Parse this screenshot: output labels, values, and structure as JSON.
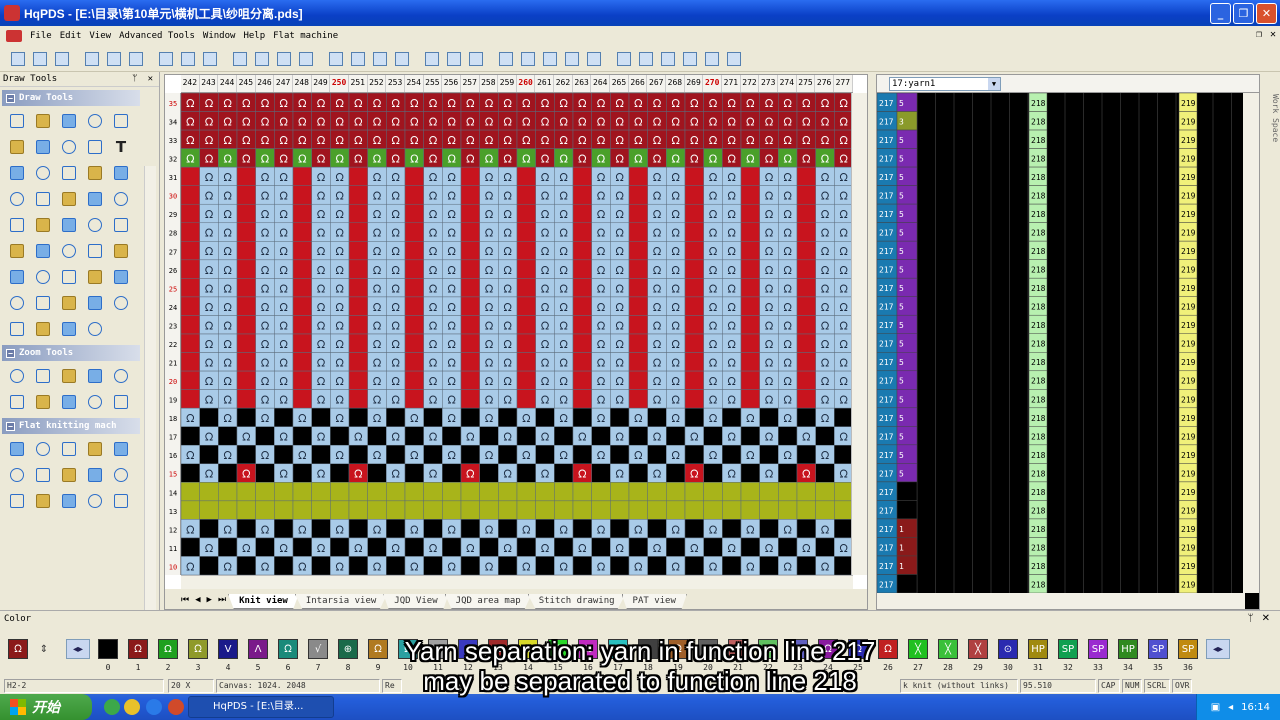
{
  "window": {
    "title": "HqPDS - [E:\\目录\\第10单元\\横机工具\\纱咀分离.pds]"
  },
  "menu": [
    "File",
    "Edit",
    "View",
    "Advanced Tools",
    "Window",
    "Help",
    "Flat machine"
  ],
  "left_panel": {
    "header": "Draw Tools",
    "pin": "ᛘ",
    "close": "✕",
    "groups": [
      {
        "title": "Draw Tools",
        "tools": 44
      },
      {
        "title": "Zoom Tools",
        "tools": 10
      },
      {
        "title": "Flat knitting mach",
        "tools": 15
      }
    ]
  },
  "knit_view": {
    "ruler": [
      "242",
      "243",
      "244",
      "245",
      "246",
      "247",
      "248",
      "249",
      "250",
      "251",
      "252",
      "253",
      "254",
      "255",
      "256",
      "257",
      "258",
      "259",
      "260",
      "261",
      "262",
      "263",
      "264",
      "265",
      "266",
      "267",
      "268",
      "269",
      "270",
      "271",
      "272",
      "273",
      "274",
      "275",
      "276",
      "277"
    ],
    "ruler_highlight": [
      "250",
      "260",
      "270"
    ],
    "row_labels": [
      "35",
      "34",
      "33",
      "32",
      "31",
      "30",
      "29",
      "28",
      "27",
      "26",
      "25",
      "24",
      "23",
      "22",
      "21",
      "20",
      "19",
      "18",
      "17",
      "16",
      "15",
      "14",
      "13",
      "12",
      "11",
      "10"
    ],
    "tabs": [
      "Knit view",
      "Intarsia view",
      "JQD View",
      "JQD area map",
      "Stitch drawing",
      "PAT view"
    ],
    "active_tab": "Knit view",
    "nav": [
      "⏮",
      "◀",
      "▶",
      "⏭"
    ]
  },
  "yarn_view": {
    "selector": "17:yarn1",
    "col1": "217",
    "col2_values": [
      "5",
      "3",
      "5",
      "5",
      "5",
      "5",
      "5",
      "5",
      "5",
      "5",
      "5",
      "5",
      "5",
      "5",
      "5",
      "5",
      "5",
      "5",
      "5",
      "5",
      "5",
      "",
      "",
      "1",
      "1",
      "1",
      ""
    ],
    "col3": "218",
    "col4": "219",
    "workspace_label": "Work Space"
  },
  "color_panel": {
    "title": "Color",
    "swatches": [
      {
        "n": "0",
        "color": "#000000",
        "sym": ""
      },
      {
        "n": "1",
        "color": "#8b1a1a",
        "sym": "ᘯ"
      },
      {
        "n": "2",
        "color": "#1fa01f",
        "sym": "Ω"
      },
      {
        "n": "3",
        "color": "#8f9a2a",
        "sym": "ᘯ"
      },
      {
        "n": "4",
        "color": "#1a1a8a",
        "sym": "V"
      },
      {
        "n": "5",
        "color": "#7a1a8a",
        "sym": "Λ"
      },
      {
        "n": "6",
        "color": "#1a8a7a",
        "sym": "ᘯ"
      },
      {
        "n": "7",
        "color": "#8a8a8a",
        "sym": "√"
      },
      {
        "n": "8",
        "color": "#1a6a4a",
        "sym": "⊕"
      },
      {
        "n": "9",
        "color": "#b07a20",
        "sym": "ᘯ"
      },
      {
        "n": "10",
        "color": "#2aa0a0",
        "sym": "ᘯ"
      },
      {
        "n": "11",
        "color": "#a0a0a0",
        "sym": "ᘯ"
      },
      {
        "n": "12",
        "color": "#3a3ac0",
        "sym": "ᘯ"
      },
      {
        "n": "13",
        "color": "#a02a2a",
        "sym": "ᘯ"
      },
      {
        "n": "14",
        "color": "#d8d82a",
        "sym": "ᘯ"
      },
      {
        "n": "15",
        "color": "#2ad82a",
        "sym": "ᘯ"
      },
      {
        "n": "16",
        "color": "#c02ac0",
        "sym": "ᘯ"
      },
      {
        "n": "17",
        "color": "#2ac0c0",
        "sym": "ᘯ"
      },
      {
        "n": "18",
        "color": "#404040",
        "sym": "ᘯ"
      },
      {
        "n": "19",
        "color": "#a0602a",
        "sym": "ᘯ"
      },
      {
        "n": "20",
        "color": "#606060",
        "sym": "ᘯ"
      },
      {
        "n": "21",
        "color": "#c06060",
        "sym": "ᘯ"
      },
      {
        "n": "22",
        "color": "#60c060",
        "sym": "ᘯ"
      },
      {
        "n": "23",
        "color": "#6060c0",
        "sym": "ᘯ"
      },
      {
        "n": "24",
        "color": "#8a1aa0",
        "sym": "ᘯ"
      },
      {
        "n": "25",
        "color": "#2a2ab0",
        "sym": "ᘯ"
      },
      {
        "n": "26",
        "color": "#c02020",
        "sym": "ᘯ"
      },
      {
        "n": "27",
        "color": "#20c020",
        "sym": "╳"
      },
      {
        "n": "28",
        "color": "#3ac03a",
        "sym": "╳"
      },
      {
        "n": "29",
        "color": "#b04040",
        "sym": "╳"
      },
      {
        "n": "30",
        "color": "#2a2ab0",
        "sym": "⊙"
      },
      {
        "n": "31",
        "color": "#a08a10",
        "sym": "HP"
      },
      {
        "n": "32",
        "color": "#10a050",
        "sym": "SP"
      },
      {
        "n": "33",
        "color": "#9a2ad0",
        "sym": "SP"
      },
      {
        "n": "34",
        "color": "#308a20",
        "sym": "HP"
      },
      {
        "n": "35",
        "color": "#5050d0",
        "sym": "SP"
      },
      {
        "n": "36",
        "color": "#c08a10",
        "sym": "SP"
      }
    ]
  },
  "status": {
    "c1": "H2-2",
    "c2": "20 X",
    "c3": "Canvas: 1024. 2048",
    "c4": "Re",
    "c5": "k knit (without links)",
    "c6": "95.510",
    "c7": "CAP",
    "c8": "NUM",
    "c9": "SCRL",
    "c10": "OVR"
  },
  "taskbar": {
    "start": "开始",
    "task": "HqPDS - [E:\\目录...",
    "time": "16:14"
  },
  "subtitle": {
    "line1": "Yarn separation: yarn in function line 217",
    "line2": "may be separated to function line 218"
  }
}
